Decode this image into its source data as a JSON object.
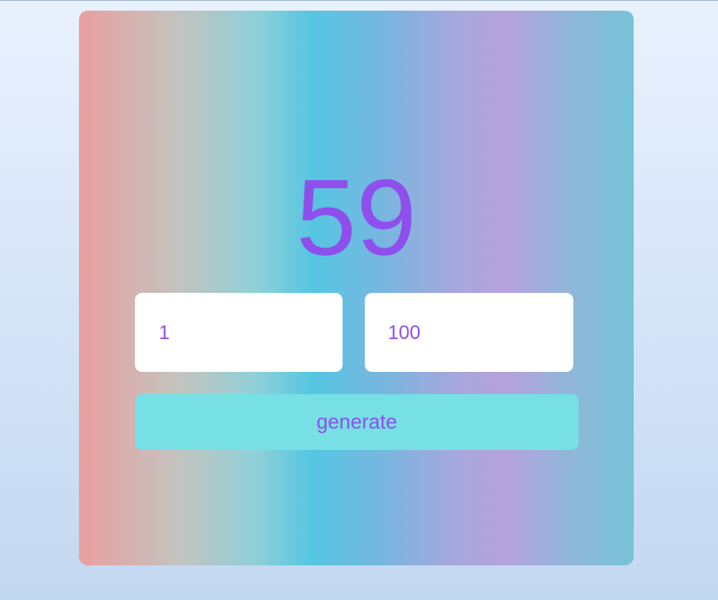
{
  "generator": {
    "result": "59",
    "min_value": "1",
    "max_value": "100",
    "generate_label": "generate"
  },
  "colors": {
    "accent": "#8e4fec",
    "button_bg": "#76e0e5",
    "field_bg": "#ffffff"
  }
}
